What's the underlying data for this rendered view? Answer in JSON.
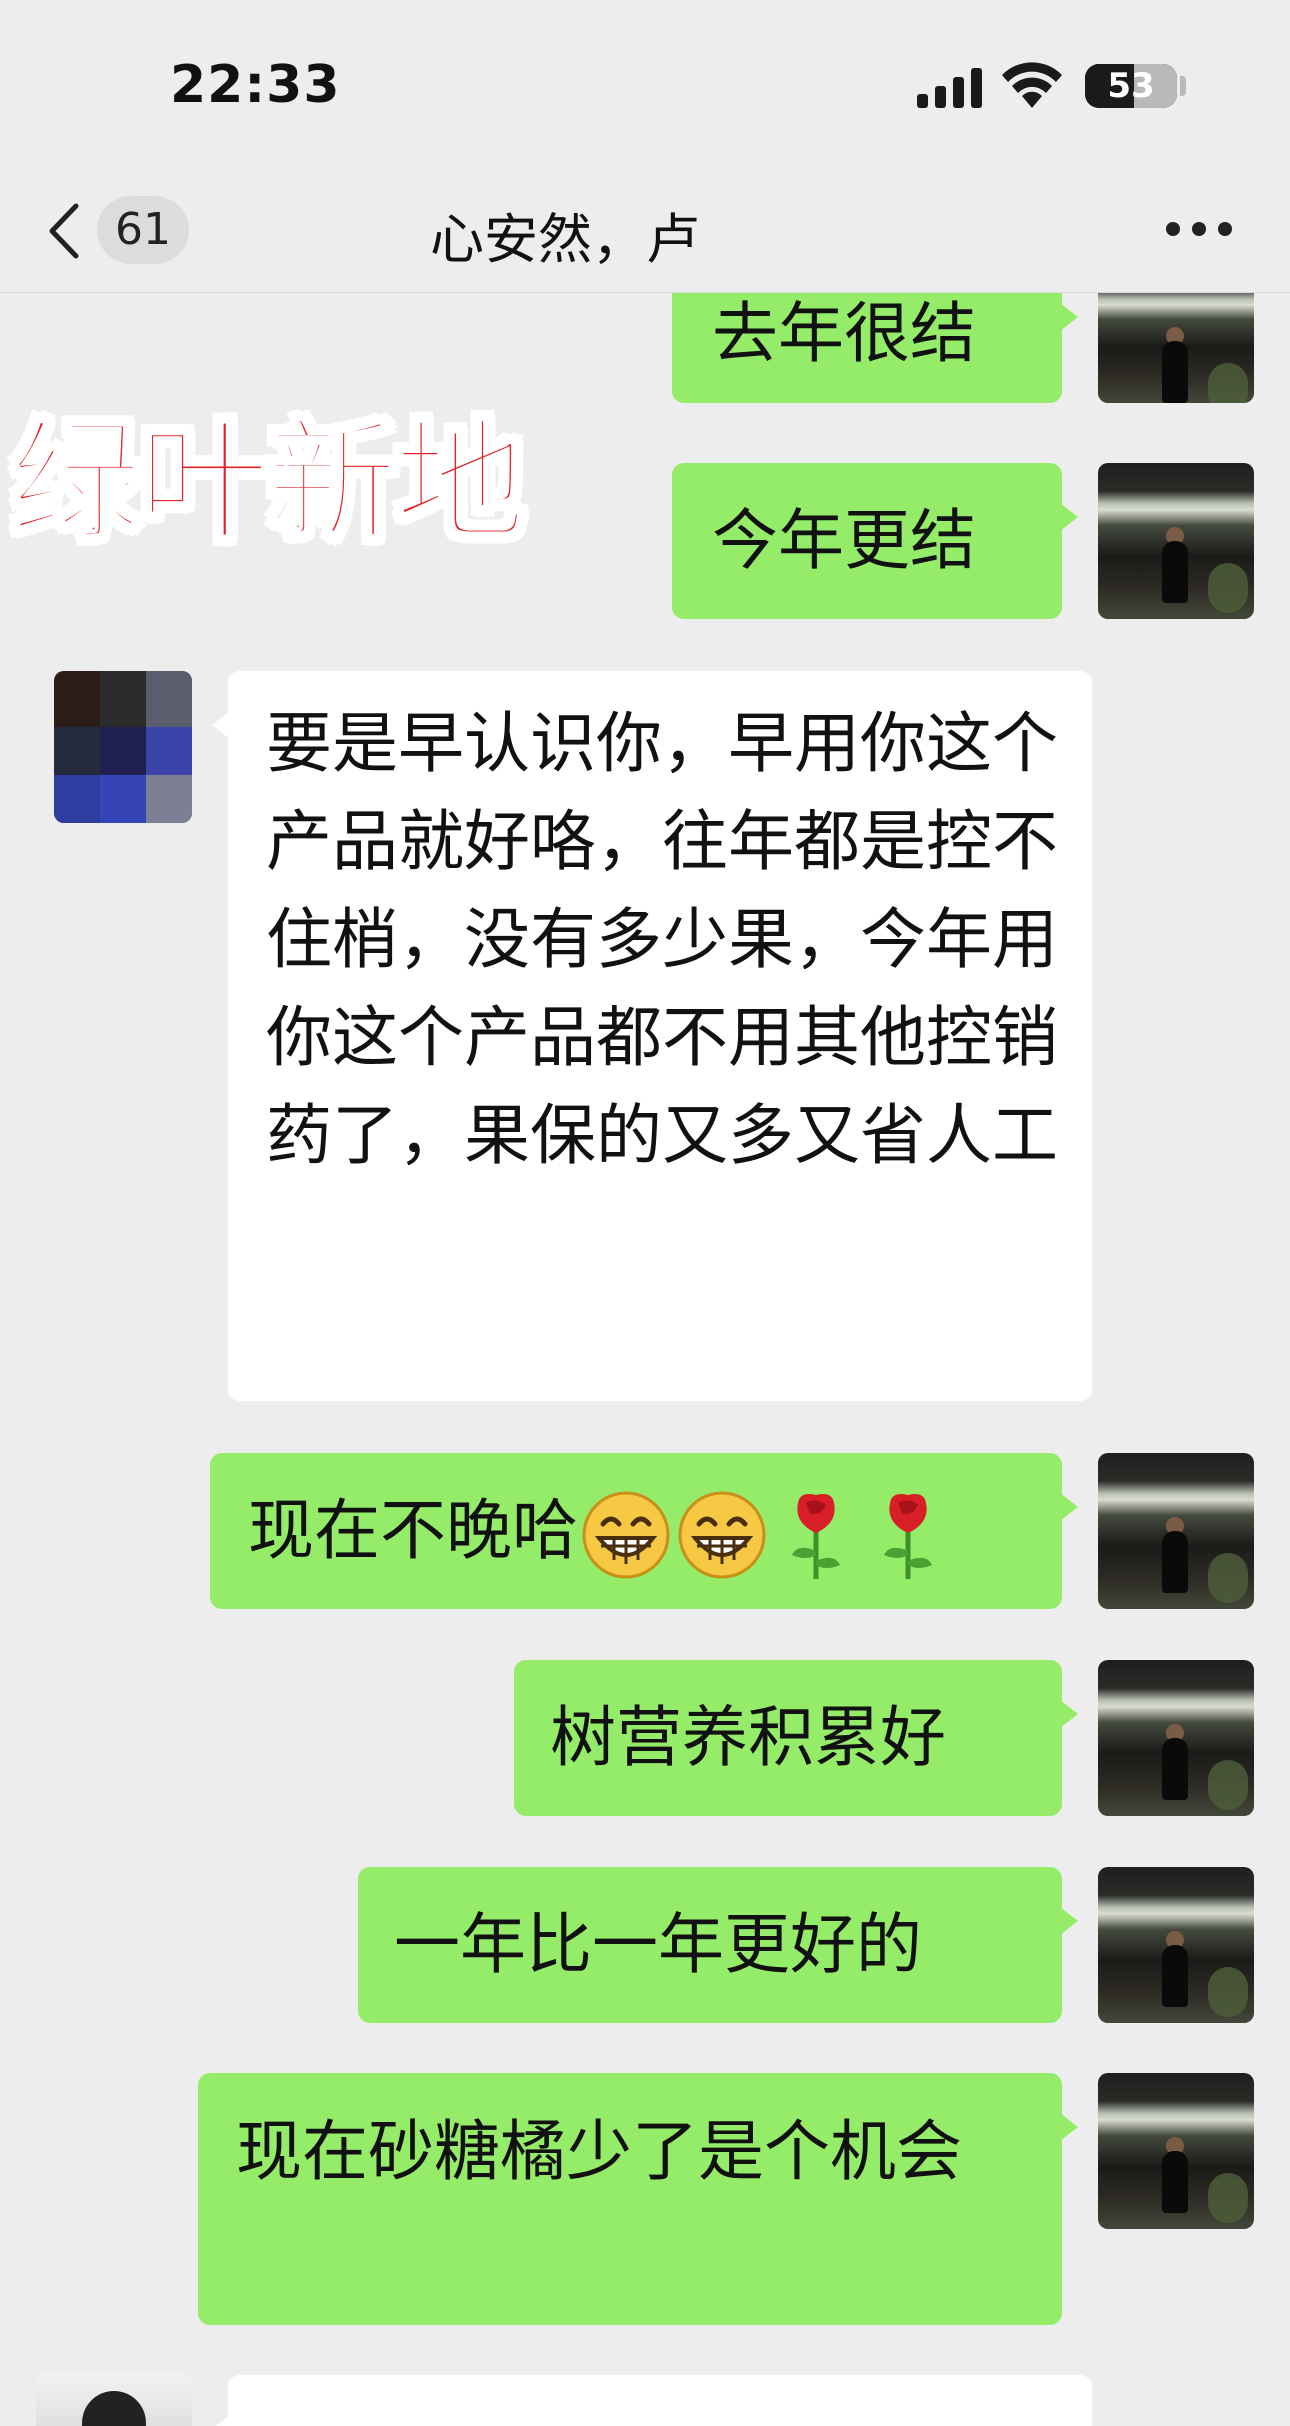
{
  "status_bar": {
    "time": "22:33",
    "battery": "53",
    "battery_percent": 53
  },
  "nav": {
    "unread_count": "61",
    "title": "心安然，卢"
  },
  "watermark": "绿叶新地",
  "messages": [
    {
      "side": "out",
      "text": "去年很结"
    },
    {
      "side": "out",
      "text": "今年更结"
    },
    {
      "side": "in",
      "text": "要是早认识你，早用你这个产品就好咯，往年都是控不住梢，没有多少果，今年用你这个产品都不用其他控销药了，果保的又多又省人工"
    },
    {
      "side": "out",
      "text": "现在不晚哈",
      "emojis": [
        "grin-icon",
        "grin-icon",
        "rose-icon",
        "rose-icon"
      ]
    },
    {
      "side": "out",
      "text": "树营养积累好"
    },
    {
      "side": "out",
      "text": "一年比一年更好的"
    },
    {
      "side": "out",
      "text": "现在砂糖橘少了是个机会"
    }
  ],
  "colors": {
    "background": "#ededed",
    "outgoing_bubble": "#95ec69",
    "incoming_bubble": "#ffffff",
    "watermark": "#e2242a"
  }
}
